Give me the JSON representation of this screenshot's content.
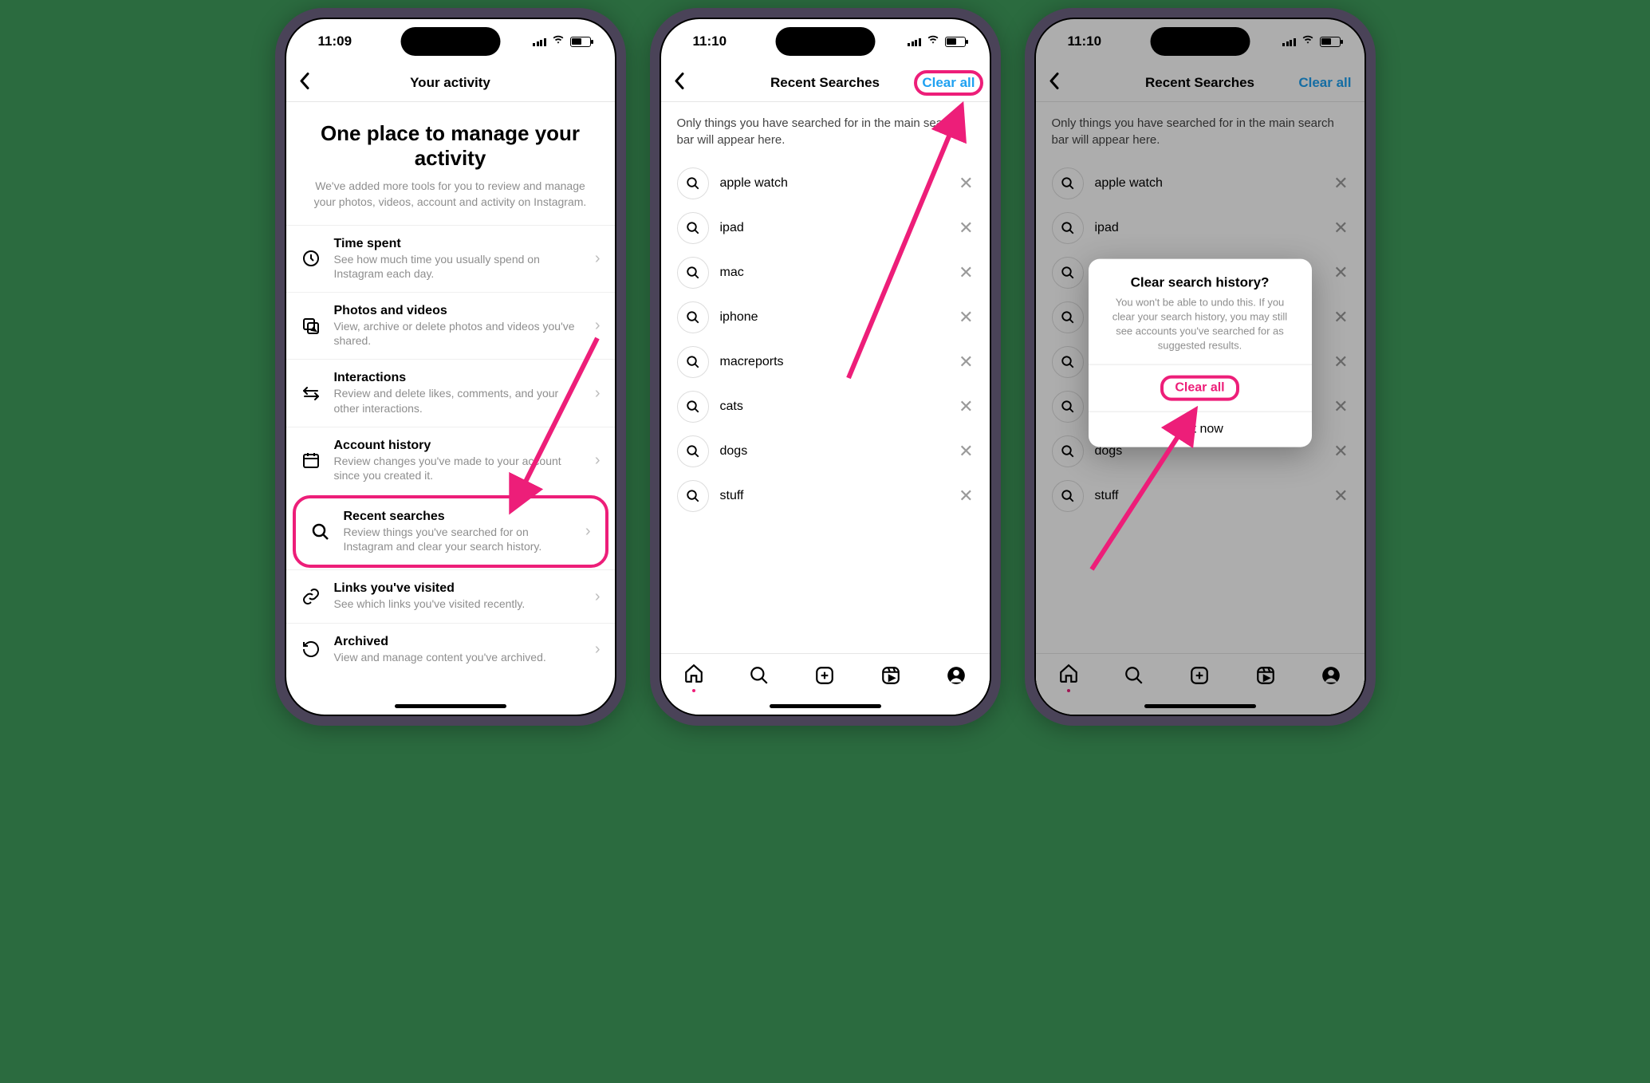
{
  "screen1": {
    "time": "11:09",
    "nav_title": "Your activity",
    "hero_title": "One place to manage your activity",
    "hero_sub": "We've added more tools for you to review and manage your photos, videos, account and activity on Instagram.",
    "items": [
      {
        "title": "Time spent",
        "sub": "See how much time you usually spend on Instagram each day."
      },
      {
        "title": "Photos and videos",
        "sub": "View, archive or delete photos and videos you've shared."
      },
      {
        "title": "Interactions",
        "sub": "Review and delete likes, comments, and your other interactions."
      },
      {
        "title": "Account history",
        "sub": "Review changes you've made to your account since you created it."
      },
      {
        "title": "Recent searches",
        "sub": "Review things you've searched for on Instagram and clear your search history."
      },
      {
        "title": "Links you've visited",
        "sub": "See which links you've visited recently."
      },
      {
        "title": "Archived",
        "sub": "View and manage content you've archived."
      }
    ]
  },
  "screen2": {
    "time": "11:10",
    "nav_title": "Recent Searches",
    "nav_action": "Clear all",
    "info": "Only things you have searched for in the main search bar will appear here.",
    "searches": [
      "apple watch",
      "ipad",
      "mac",
      "iphone",
      "macreports",
      "cats",
      "dogs",
      "stuff"
    ]
  },
  "screen3": {
    "time": "11:10",
    "nav_title": "Recent Searches",
    "nav_action": "Clear all",
    "info": "Only things you have searched for in the main search bar will appear here.",
    "searches": [
      "apple watch",
      "ipad",
      "mac",
      "iphone",
      "macreports",
      "cats",
      "dogs",
      "stuff"
    ],
    "modal": {
      "title": "Clear search history?",
      "msg": "You won't be able to undo this. If you clear your search history, you may still see accounts you've searched for as suggested results.",
      "clear": "Clear all",
      "notnow": "Not now"
    }
  }
}
